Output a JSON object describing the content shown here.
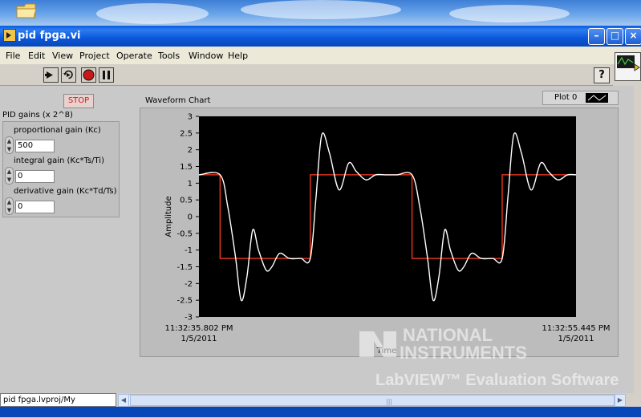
{
  "window": {
    "title": "pid fpga.vi"
  },
  "menu": [
    "File",
    "Edit",
    "View",
    "Project",
    "Operate",
    "Tools",
    "Window",
    "Help"
  ],
  "toolbar": {
    "help_label": "?"
  },
  "front_panel": {
    "stop_label": "STOP",
    "cluster_label": "PID gains (x 2^8)",
    "controls": [
      {
        "label": "proportional gain (Kc)",
        "value": "500"
      },
      {
        "label": "integral gain (Kc*Ts/Ti)",
        "value": "0"
      },
      {
        "label": "derivative gain (Kc*Td/Ts)",
        "value": "0"
      }
    ]
  },
  "chart": {
    "title": "Waveform Chart",
    "legend_label": "Plot 0",
    "x_start_time": "11:32:35.802 PM",
    "x_start_date": "1/5/2011",
    "x_end_time": "11:32:55.445 PM",
    "x_end_date": "1/5/2011",
    "ylabel": "Amplitude",
    "xlabel": "Time"
  },
  "chart_data": {
    "type": "line",
    "title": "Waveform Chart",
    "xlabel": "Time",
    "ylabel": "Amplitude",
    "ylim": [
      -3,
      3
    ],
    "yticks": [
      3,
      2.5,
      2,
      1.5,
      1,
      0.5,
      0,
      -0.5,
      -1,
      -1.5,
      -2,
      -2.5,
      -3
    ],
    "ytick_labels": [
      "3",
      "2.5",
      "2",
      "1.5",
      "1",
      "0.5",
      "0",
      "-0.5",
      "-1",
      "-1.5",
      "-2",
      "-2.5",
      "-3"
    ],
    "xlim": [
      "11:32:35.802 PM 1/5/2011",
      "11:32:55.445 PM 1/5/2011"
    ],
    "grid": false,
    "background": "#000000",
    "series": [
      {
        "color": "#ff3b1f",
        "x": [
          0,
          1.1,
          1.1,
          5.8,
          5.8,
          11.1,
          11.1,
          15.8,
          15.8,
          19.643
        ],
        "values": [
          1.25,
          1.25,
          -1.25,
          -1.25,
          1.25,
          1.25,
          -1.25,
          -1.25,
          1.25,
          1.25
        ]
      },
      {
        "color": "#ffffff",
        "x": [
          0,
          1.1,
          1.5,
          1.9,
          2.2,
          2.5,
          2.8,
          3.1,
          3.5,
          3.8,
          4.2,
          4.7,
          5.3,
          5.8,
          6.1,
          6.4,
          6.8,
          7.3,
          7.8,
          8.2,
          8.7,
          9.2,
          9.7,
          10.3,
          11.1,
          11.5,
          11.9,
          12.2,
          12.5,
          12.8,
          13.1,
          13.5,
          13.8,
          14.2,
          14.7,
          15.3,
          15.8,
          16.1,
          16.4,
          16.8,
          17.3,
          17.8,
          18.2,
          18.7,
          19.2,
          19.643
        ],
        "values": [
          1.25,
          1.25,
          0.3,
          -1.2,
          -2.5,
          -1.8,
          -0.4,
          -1.0,
          -1.6,
          -1.5,
          -1.1,
          -1.25,
          -1.25,
          -1.25,
          0.6,
          2.45,
          1.9,
          0.8,
          1.6,
          1.35,
          1.1,
          1.25,
          1.25,
          1.25,
          1.25,
          0.3,
          -1.2,
          -2.5,
          -1.8,
          -0.4,
          -1.0,
          -1.6,
          -1.5,
          -1.1,
          -1.25,
          -1.25,
          -1.25,
          0.6,
          2.45,
          1.9,
          0.8,
          1.6,
          1.35,
          1.1,
          1.25,
          1.25
        ]
      }
    ]
  },
  "status": {
    "path": "pid fpga.lvproj/My Computer"
  },
  "watermark": {
    "brand_line1": "NATIONAL",
    "brand_line2": "INSTRUMENTS",
    "product": "LabVIEW™ Evaluation Software"
  },
  "colors": {
    "titlebar": "#0a5ce0",
    "plot_bg": "#000000",
    "stop_text": "#d31c1c"
  }
}
